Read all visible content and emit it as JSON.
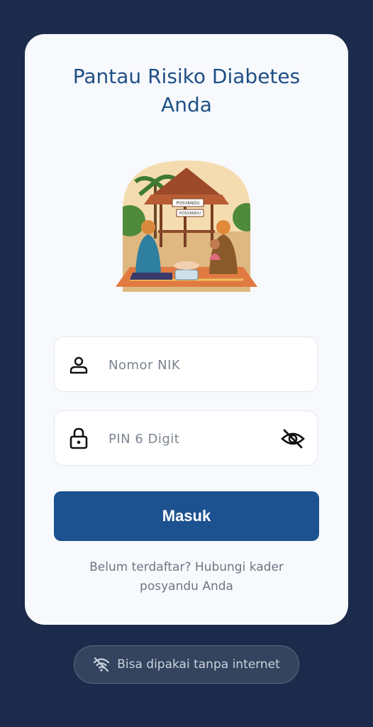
{
  "header": {
    "title": "Pantau Risiko Diabetes Anda"
  },
  "illustration": {
    "sign_top": "POSYANDU",
    "sign_bottom": "POSYANDU"
  },
  "form": {
    "nik": {
      "placeholder": "Nomor NIK",
      "icon": "person-icon"
    },
    "pin": {
      "placeholder": "PIN 6 Digit",
      "icon": "lock-icon",
      "toggle_icon": "eye-off-icon"
    },
    "submit_label": "Masuk"
  },
  "footer_hint": "Belum terdaftar? Hubungi kader posyandu Anda",
  "offline_badge": {
    "label": "Bisa dipakai tanpa internet",
    "icon": "wifi-off-icon"
  },
  "colors": {
    "background": "#1c2b4b",
    "primary": "#1d5290",
    "title": "#1f4f85"
  }
}
